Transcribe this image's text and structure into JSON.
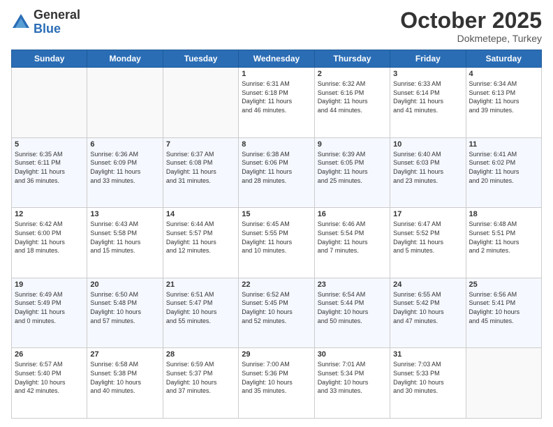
{
  "logo": {
    "general": "General",
    "blue": "Blue"
  },
  "header": {
    "month": "October 2025",
    "location": "Dokmetepe, Turkey"
  },
  "days_of_week": [
    "Sunday",
    "Monday",
    "Tuesday",
    "Wednesday",
    "Thursday",
    "Friday",
    "Saturday"
  ],
  "weeks": [
    [
      {
        "day": "",
        "info": ""
      },
      {
        "day": "",
        "info": ""
      },
      {
        "day": "",
        "info": ""
      },
      {
        "day": "1",
        "info": "Sunrise: 6:31 AM\nSunset: 6:18 PM\nDaylight: 11 hours\nand 46 minutes."
      },
      {
        "day": "2",
        "info": "Sunrise: 6:32 AM\nSunset: 6:16 PM\nDaylight: 11 hours\nand 44 minutes."
      },
      {
        "day": "3",
        "info": "Sunrise: 6:33 AM\nSunset: 6:14 PM\nDaylight: 11 hours\nand 41 minutes."
      },
      {
        "day": "4",
        "info": "Sunrise: 6:34 AM\nSunset: 6:13 PM\nDaylight: 11 hours\nand 39 minutes."
      }
    ],
    [
      {
        "day": "5",
        "info": "Sunrise: 6:35 AM\nSunset: 6:11 PM\nDaylight: 11 hours\nand 36 minutes."
      },
      {
        "day": "6",
        "info": "Sunrise: 6:36 AM\nSunset: 6:09 PM\nDaylight: 11 hours\nand 33 minutes."
      },
      {
        "day": "7",
        "info": "Sunrise: 6:37 AM\nSunset: 6:08 PM\nDaylight: 11 hours\nand 31 minutes."
      },
      {
        "day": "8",
        "info": "Sunrise: 6:38 AM\nSunset: 6:06 PM\nDaylight: 11 hours\nand 28 minutes."
      },
      {
        "day": "9",
        "info": "Sunrise: 6:39 AM\nSunset: 6:05 PM\nDaylight: 11 hours\nand 25 minutes."
      },
      {
        "day": "10",
        "info": "Sunrise: 6:40 AM\nSunset: 6:03 PM\nDaylight: 11 hours\nand 23 minutes."
      },
      {
        "day": "11",
        "info": "Sunrise: 6:41 AM\nSunset: 6:02 PM\nDaylight: 11 hours\nand 20 minutes."
      }
    ],
    [
      {
        "day": "12",
        "info": "Sunrise: 6:42 AM\nSunset: 6:00 PM\nDaylight: 11 hours\nand 18 minutes."
      },
      {
        "day": "13",
        "info": "Sunrise: 6:43 AM\nSunset: 5:58 PM\nDaylight: 11 hours\nand 15 minutes."
      },
      {
        "day": "14",
        "info": "Sunrise: 6:44 AM\nSunset: 5:57 PM\nDaylight: 11 hours\nand 12 minutes."
      },
      {
        "day": "15",
        "info": "Sunrise: 6:45 AM\nSunset: 5:55 PM\nDaylight: 11 hours\nand 10 minutes."
      },
      {
        "day": "16",
        "info": "Sunrise: 6:46 AM\nSunset: 5:54 PM\nDaylight: 11 hours\nand 7 minutes."
      },
      {
        "day": "17",
        "info": "Sunrise: 6:47 AM\nSunset: 5:52 PM\nDaylight: 11 hours\nand 5 minutes."
      },
      {
        "day": "18",
        "info": "Sunrise: 6:48 AM\nSunset: 5:51 PM\nDaylight: 11 hours\nand 2 minutes."
      }
    ],
    [
      {
        "day": "19",
        "info": "Sunrise: 6:49 AM\nSunset: 5:49 PM\nDaylight: 11 hours\nand 0 minutes."
      },
      {
        "day": "20",
        "info": "Sunrise: 6:50 AM\nSunset: 5:48 PM\nDaylight: 10 hours\nand 57 minutes."
      },
      {
        "day": "21",
        "info": "Sunrise: 6:51 AM\nSunset: 5:47 PM\nDaylight: 10 hours\nand 55 minutes."
      },
      {
        "day": "22",
        "info": "Sunrise: 6:52 AM\nSunset: 5:45 PM\nDaylight: 10 hours\nand 52 minutes."
      },
      {
        "day": "23",
        "info": "Sunrise: 6:54 AM\nSunset: 5:44 PM\nDaylight: 10 hours\nand 50 minutes."
      },
      {
        "day": "24",
        "info": "Sunrise: 6:55 AM\nSunset: 5:42 PM\nDaylight: 10 hours\nand 47 minutes."
      },
      {
        "day": "25",
        "info": "Sunrise: 6:56 AM\nSunset: 5:41 PM\nDaylight: 10 hours\nand 45 minutes."
      }
    ],
    [
      {
        "day": "26",
        "info": "Sunrise: 6:57 AM\nSunset: 5:40 PM\nDaylight: 10 hours\nand 42 minutes."
      },
      {
        "day": "27",
        "info": "Sunrise: 6:58 AM\nSunset: 5:38 PM\nDaylight: 10 hours\nand 40 minutes."
      },
      {
        "day": "28",
        "info": "Sunrise: 6:59 AM\nSunset: 5:37 PM\nDaylight: 10 hours\nand 37 minutes."
      },
      {
        "day": "29",
        "info": "Sunrise: 7:00 AM\nSunset: 5:36 PM\nDaylight: 10 hours\nand 35 minutes."
      },
      {
        "day": "30",
        "info": "Sunrise: 7:01 AM\nSunset: 5:34 PM\nDaylight: 10 hours\nand 33 minutes."
      },
      {
        "day": "31",
        "info": "Sunrise: 7:03 AM\nSunset: 5:33 PM\nDaylight: 10 hours\nand 30 minutes."
      },
      {
        "day": "",
        "info": ""
      }
    ]
  ]
}
